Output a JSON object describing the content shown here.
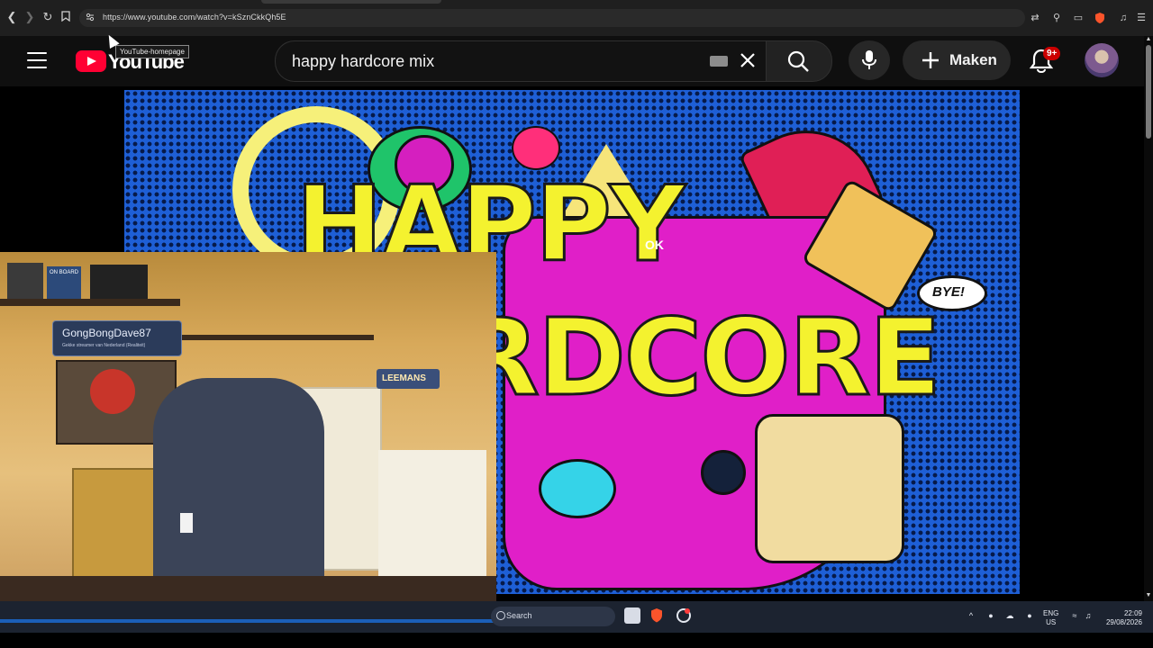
{
  "browser": {
    "url": "https://www.youtube.com/watch?v=kSznCkkQh5E"
  },
  "header": {
    "logo_text": "YouTube",
    "tooltip": "YouTube-homepage",
    "search_value": "happy hardcore mix",
    "create_label": "Maken",
    "notification_count": "9+"
  },
  "video": {
    "art_line1": "HAPPY",
    "art_line2": "RDCORE",
    "art_ok": "OK",
    "art_bye": "BYE!"
  },
  "webcam": {
    "name_tag": "GongBongDave87",
    "name_sub": "Gekke streamer van Nederland (Realiteit)",
    "box_label": "LEEMANS",
    "sign_label": "ON BOARD"
  },
  "taskbar": {
    "search_label": "Search",
    "language_line1": "ENG",
    "language_line2": "US",
    "time": "22:09",
    "date": "29/08/2026"
  },
  "colors": {
    "youtube_red": "#ff0033",
    "video_blue": "#1e5fd6",
    "art_yellow": "#f4f22f",
    "art_magenta": "#e01fc8",
    "badge_red": "#cc0000"
  }
}
